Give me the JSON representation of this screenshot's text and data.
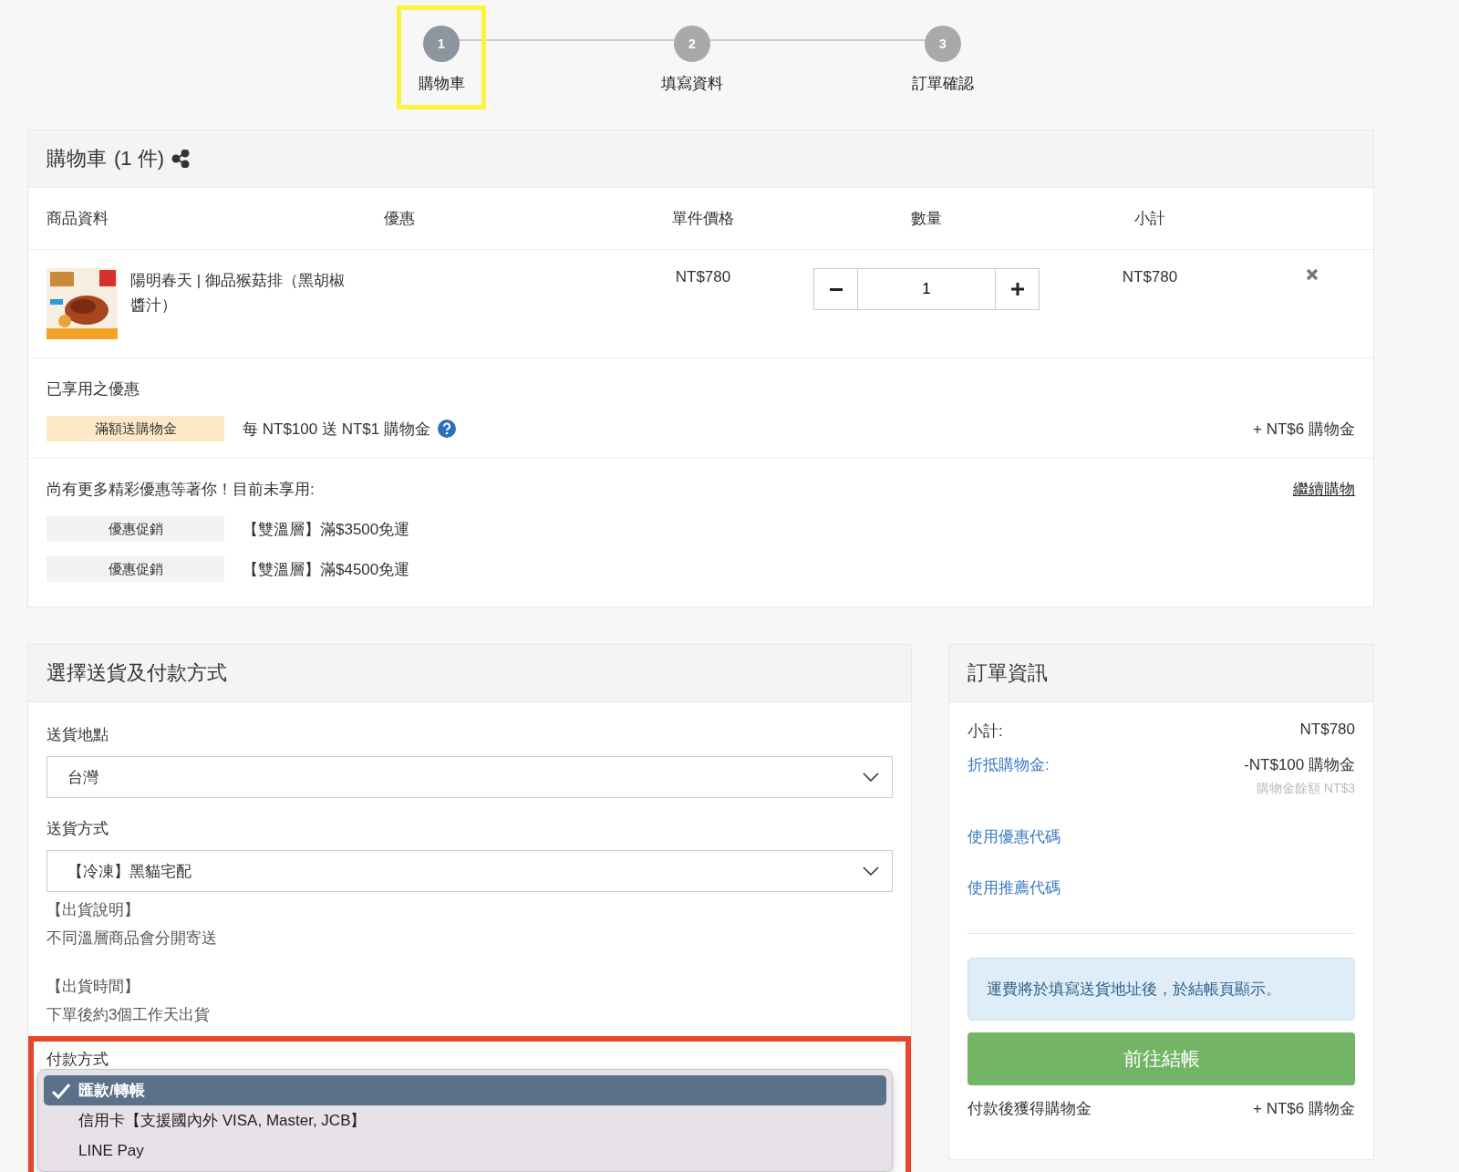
{
  "steps": [
    {
      "number": "1",
      "label": "購物車",
      "selected": true,
      "highlighted": true
    },
    {
      "number": "2",
      "label": "填寫資料",
      "selected": false,
      "highlighted": false
    },
    {
      "number": "3",
      "label": "訂單確認",
      "selected": false,
      "highlighted": false
    }
  ],
  "cart": {
    "title": "購物車",
    "count": "(1 件)",
    "columns": [
      "商品資料",
      "優惠",
      "單件價格",
      "數量",
      "小計"
    ],
    "items": [
      {
        "name": "陽明春天 | 御品猴菇排（黑胡椒醬汁）",
        "price": "NT$780",
        "quantity": "1",
        "subtotal": "NT$780"
      }
    ],
    "applied": {
      "title": "已享用之優惠",
      "promos": [
        {
          "tag": "滿額送購物金",
          "text": "每 NT$100 送 NT$1 購物金",
          "reward": "+ NT$6 購物金"
        }
      ]
    },
    "more": {
      "title": "尚有更多精彩優惠等著你！目前未享用:",
      "link": "繼續購物",
      "promos": [
        {
          "tag": "優惠促銷",
          "text": "【雙溫層】滿$3500免運"
        },
        {
          "tag": "優惠促銷",
          "text": "【雙溫層】滿$4500免運"
        }
      ]
    }
  },
  "shipping": {
    "title": "選擇送貨及付款方式",
    "selects": [
      {
        "label": "送貨地點",
        "value": "台灣"
      },
      {
        "label": "送貨方式",
        "value": "【冷凍】黑貓宅配"
      }
    ],
    "notes": [
      {
        "heading": "【出貨說明】",
        "text": "不同溫層商品會分開寄送"
      },
      {
        "heading": "【出貨時間】",
        "text": "下單後約3個工作天出貨"
      }
    ],
    "payment": {
      "label": "付款方式",
      "highlighted": true,
      "options": [
        {
          "label": "匯款/轉帳",
          "selected": true
        },
        {
          "label": "信用卡【支援國內外 VISA, Master, JCB】",
          "selected": false
        },
        {
          "label": "LINE Pay",
          "selected": false
        }
      ]
    }
  },
  "order": {
    "title": "訂單資訊",
    "rows": [
      {
        "label": "小計:",
        "value": "NT$780",
        "link": false
      },
      {
        "label": "折抵購物金:",
        "value": "-NT$100 購物金",
        "note": "購物金餘額 NT$3",
        "link": true
      }
    ],
    "links": [
      "使用優惠代碼",
      "使用推薦代碼"
    ],
    "notice": "運費將於填寫送貨地址後，於結帳頁顯示。",
    "checkout": "前往結帳",
    "reward": {
      "label": "付款後獲得購物金",
      "value": "+ NT$6 購物金"
    }
  }
}
